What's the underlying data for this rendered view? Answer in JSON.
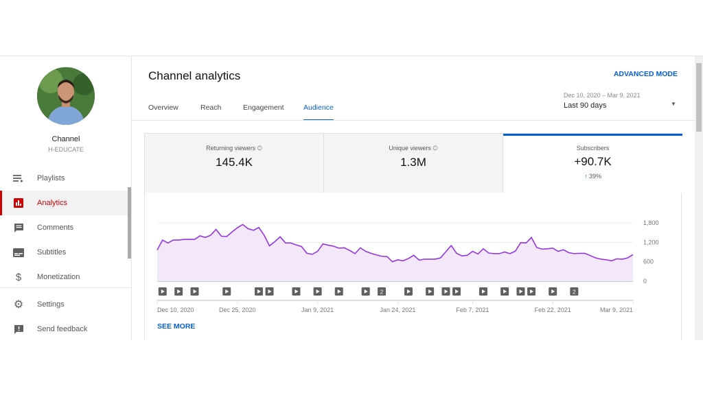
{
  "channel": {
    "label": "Channel",
    "name": "H-EDUCATE"
  },
  "sidebar": {
    "items": [
      {
        "label": "Playlists",
        "icon": "playlist-icon"
      },
      {
        "label": "Analytics",
        "icon": "analytics-icon"
      },
      {
        "label": "Comments",
        "icon": "comments-icon"
      },
      {
        "label": "Subtitles",
        "icon": "subtitles-icon"
      },
      {
        "label": "Monetization",
        "icon": "dollar-icon"
      },
      {
        "label": "Settings",
        "icon": "gear-icon"
      },
      {
        "label": "Send feedback",
        "icon": "feedback-icon"
      }
    ]
  },
  "header": {
    "title": "Channel analytics",
    "advanced": "ADVANCED MODE"
  },
  "tabs": [
    "Overview",
    "Reach",
    "Engagement",
    "Audience"
  ],
  "date_range": {
    "dates": "Dec 10, 2020 – Mar 9, 2021",
    "label": "Last 90 days"
  },
  "metrics": [
    {
      "label": "Returning viewers",
      "value": "145.4K"
    },
    {
      "label": "Unique viewers",
      "value": "1.3M"
    },
    {
      "label": "Subscribers",
      "value": "+90.7K",
      "delta": "39%"
    }
  ],
  "see_more": "SEE MORE",
  "colors": {
    "accent": "#065fd4",
    "line": "#9334e6",
    "fill": "#f3e8f9",
    "red": "#cc0000"
  },
  "chart_data": {
    "type": "area",
    "ylim": [
      0,
      1800
    ],
    "yticks": [
      "0",
      "600",
      "1,200",
      "1,800"
    ],
    "ytick_values": [
      0,
      600,
      1200,
      1800
    ],
    "xticks": [
      {
        "label": "Dec 10, 2020",
        "day": 0
      },
      {
        "label": "Dec 25, 2020",
        "day": 15
      },
      {
        "label": "Jan 9, 2021",
        "day": 30
      },
      {
        "label": "Jan 24, 2021",
        "day": 45
      },
      {
        "label": "Feb 7, 2021",
        "day": 59
      },
      {
        "label": "Feb 22, 2021",
        "day": 74
      },
      {
        "label": "Mar 9, 2021",
        "day": 89
      }
    ],
    "values": [
      960,
      1270,
      1180,
      1270,
      1270,
      1290,
      1290,
      1290,
      1400,
      1350,
      1420,
      1600,
      1390,
      1380,
      1520,
      1650,
      1750,
      1620,
      1570,
      1660,
      1420,
      1090,
      1220,
      1370,
      1180,
      1180,
      1120,
      1070,
      860,
      830,
      920,
      1150,
      1110,
      1080,
      1020,
      1030,
      950,
      850,
      1030,
      920,
      860,
      810,
      770,
      760,
      600,
      660,
      630,
      700,
      800,
      650,
      680,
      680,
      680,
      720,
      910,
      1100,
      860,
      780,
      800,
      920,
      840,
      1000,
      870,
      850,
      850,
      900,
      850,
      930,
      1190,
      1180,
      1350,
      1040,
      990,
      1000,
      1020,
      920,
      970,
      880,
      850,
      860,
      860,
      790,
      720,
      680,
      660,
      630,
      690,
      680,
      720,
      820
    ],
    "video_markers": [
      {
        "day": 1
      },
      {
        "day": 4
      },
      {
        "day": 7
      },
      {
        "day": 13
      },
      {
        "day": 19
      },
      {
        "day": 21
      },
      {
        "day": 26
      },
      {
        "day": 30
      },
      {
        "day": 34
      },
      {
        "day": 39
      },
      {
        "day": 42,
        "count": "2"
      },
      {
        "day": 47
      },
      {
        "day": 51
      },
      {
        "day": 54
      },
      {
        "day": 56
      },
      {
        "day": 61
      },
      {
        "day": 65
      },
      {
        "day": 68
      },
      {
        "day": 70
      },
      {
        "day": 74
      },
      {
        "day": 78,
        "count": "2"
      }
    ]
  }
}
